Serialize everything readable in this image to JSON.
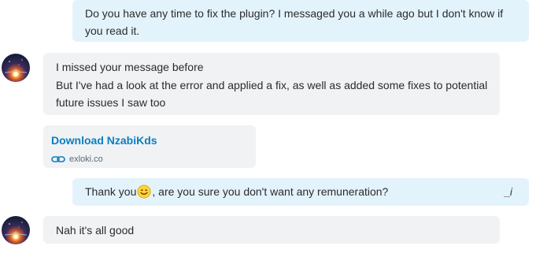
{
  "messages": {
    "m1": {
      "direction": "outgoing",
      "text": "Do you have any time to fix the plugin? I messaged you a while ago but I don't know if you read it."
    },
    "m2": {
      "direction": "incoming",
      "line1": "I missed your message before",
      "line2": "But I've had a look at the error and applied a fix, as well as added some fixes to potential future issues I saw too"
    },
    "m3": {
      "direction": "incoming",
      "link_title": "Download NzabiKds",
      "link_host": "exloki.co",
      "icon": "link-icon"
    },
    "m4": {
      "direction": "outgoing",
      "text_before": "Thank you",
      "emoji": "smiley-emoji",
      "text_after": ", are you sure you don't want any remuneration?",
      "edit_marker": "_i"
    },
    "m5": {
      "direction": "incoming",
      "text": "Nah it's all good"
    }
  },
  "colors": {
    "outgoing_bubble": "#e3f3fc",
    "incoming_bubble": "#f0f2f4",
    "link": "#0b7fc1"
  }
}
